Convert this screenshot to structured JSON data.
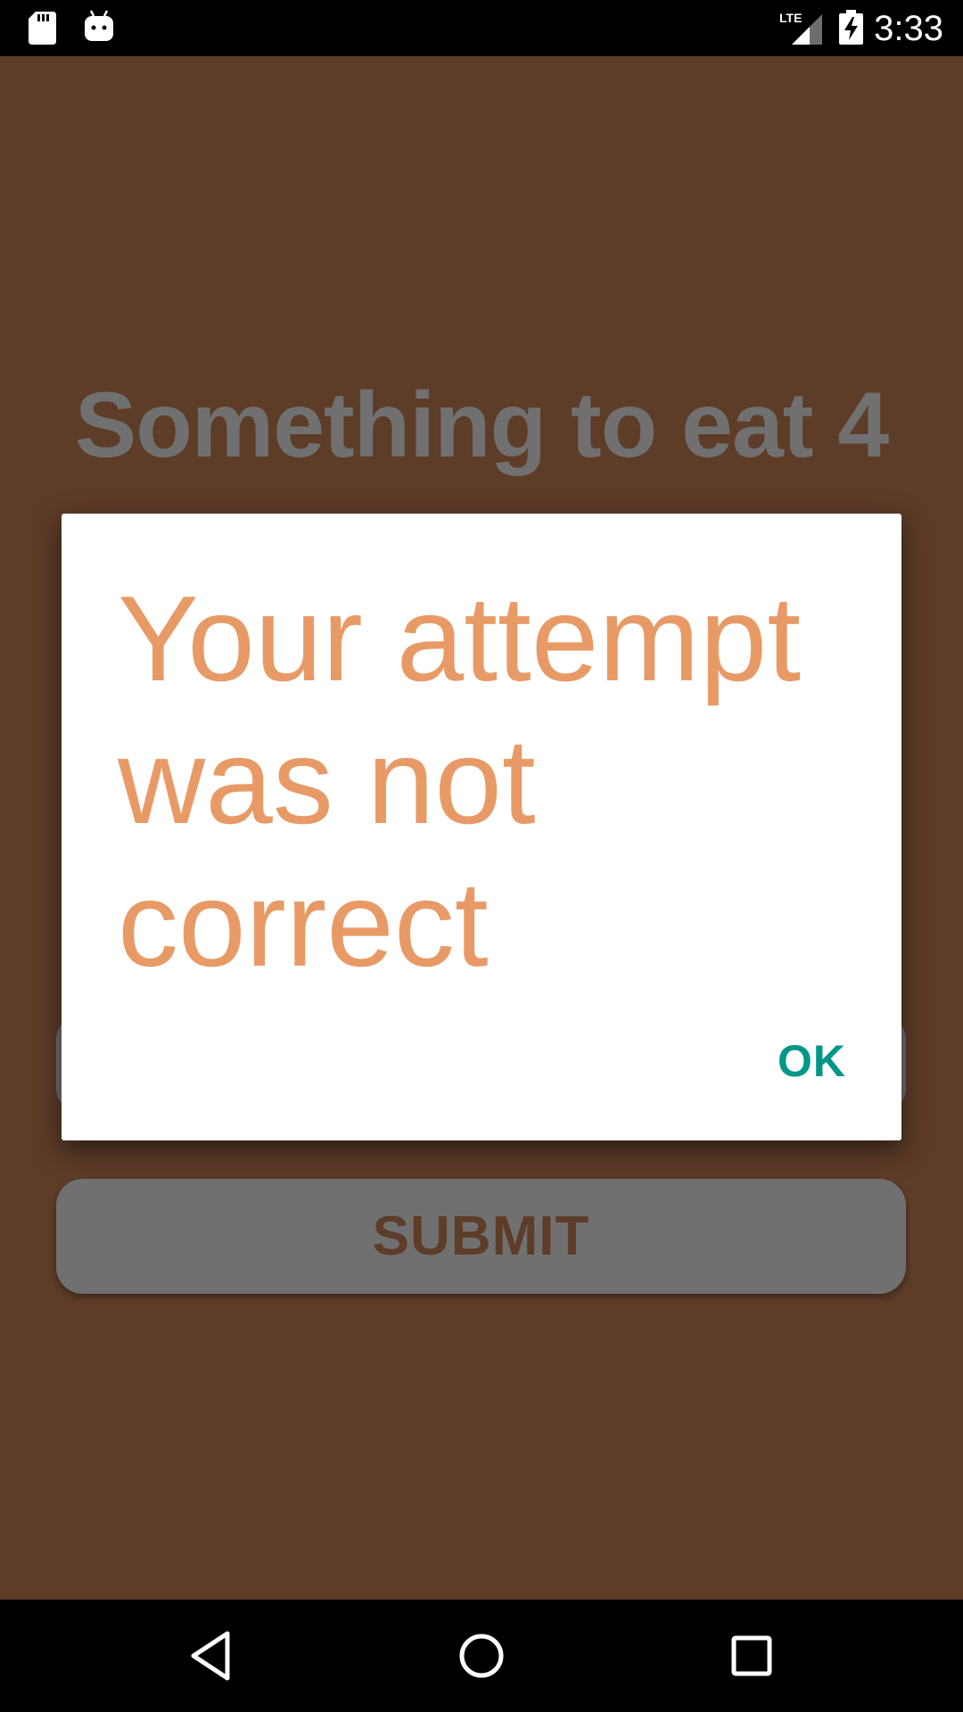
{
  "status_bar": {
    "time": "3:33",
    "network": "LTE",
    "icons": [
      "sd-card-icon",
      "android-debug-icon",
      "lte-signal-icon",
      "battery-charging-icon"
    ]
  },
  "app": {
    "title": "Something to eat 4",
    "submit_label": "SUBMIT",
    "background_color": "#8b5a3c"
  },
  "dialog": {
    "message": "Your attempt was not correct",
    "ok_label": "OK",
    "message_color": "#e89a66",
    "ok_color": "#009688"
  },
  "nav_bar": {
    "icons": [
      "back-icon",
      "home-icon",
      "recents-icon"
    ]
  }
}
